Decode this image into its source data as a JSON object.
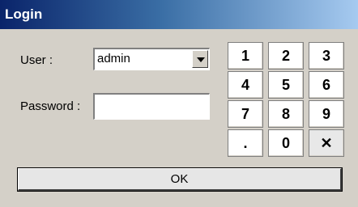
{
  "window": {
    "title": "Login"
  },
  "form": {
    "user_label": "User :",
    "user_value": "admin",
    "password_label": "Password :",
    "password_value": ""
  },
  "keypad": {
    "k1": "1",
    "k2": "2",
    "k3": "3",
    "k4": "4",
    "k5": "5",
    "k6": "6",
    "k7": "7",
    "k8": "8",
    "k9": "9",
    "kdot": ".",
    "k0": "0",
    "kclear": "✕"
  },
  "ok_label": "OK"
}
